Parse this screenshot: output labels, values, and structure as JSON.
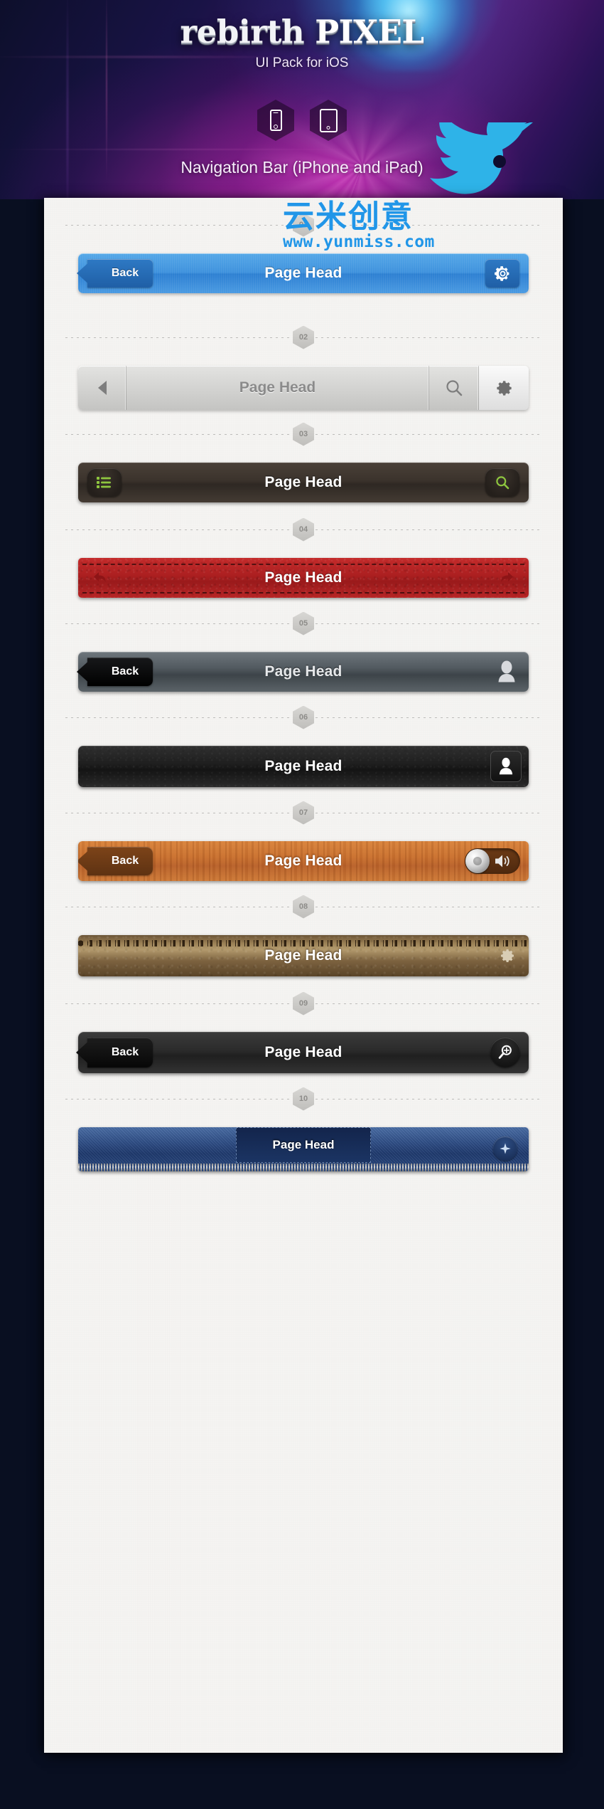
{
  "hero": {
    "brand_light": "rebirth ",
    "brand_bold": "PIXEL",
    "subtitle": "UI Pack for iOS",
    "caption": "Navigation Bar (iPhone and iPad)",
    "device_icons": [
      "iphone-icon",
      "ipad-icon"
    ],
    "bird_icon": "twitter-bird-icon"
  },
  "watermark": {
    "chinese": "云米创意",
    "url": "www.yunmiss.com",
    "color": "#2196e8"
  },
  "page_title": "Page Head",
  "back_label": "Back",
  "separators": [
    "01",
    "02",
    "03",
    "04",
    "05",
    "06",
    "07",
    "08",
    "09",
    "10"
  ],
  "bars": [
    {
      "number": "01",
      "style": "blue-glossy",
      "title": "Page Head",
      "left_label": "Back",
      "left_icon": "back-arrow-icon",
      "right_icon": "gear-icon",
      "accent": "#3f92dd"
    },
    {
      "number": "02",
      "style": "light-gray-segmented",
      "title": "Page Head",
      "left_icon": "back-triangle-icon",
      "right_icons": [
        "search-icon",
        "gear-icon"
      ],
      "accent": "#d4d4d2"
    },
    {
      "number": "03",
      "style": "dark-brown",
      "title": "Page Head",
      "left_icon": "list-icon",
      "right_icon": "search-icon",
      "accent": "#3b332c",
      "icon_color": "#8ec63f"
    },
    {
      "number": "04",
      "style": "red-leather-stitched",
      "title": "Page Head",
      "left_icon": "undo-arrow-icon",
      "right_icon": "redo-arrow-icon",
      "accent": "#b82526"
    },
    {
      "number": "05",
      "style": "gray-gradient",
      "title": "Page Head",
      "left_label": "Back",
      "right_icon": "user-icon",
      "accent": "#525a60"
    },
    {
      "number": "06",
      "style": "black-leather",
      "title": "Page Head",
      "right_icon": "user-icon",
      "accent": "#1e1e1e"
    },
    {
      "number": "07",
      "style": "wood",
      "title": "Page Head",
      "left_label": "Back",
      "right_icon": "speaker-toggle-icon",
      "accent": "#c9702f"
    },
    {
      "number": "08",
      "style": "brown-leather-stitched",
      "title": "Page Head",
      "right_icon": "gear-icon",
      "accent": "#9b8055"
    },
    {
      "number": "09",
      "style": "charcoal",
      "title": "Page Head",
      "left_label": "Back",
      "right_icon": "zoom-in-icon",
      "accent": "#2b2b2b"
    },
    {
      "number": "10",
      "style": "denim-zipper",
      "title": "Page Head",
      "right_icon": "compass-icon",
      "accent": "#2f4e86"
    }
  ]
}
